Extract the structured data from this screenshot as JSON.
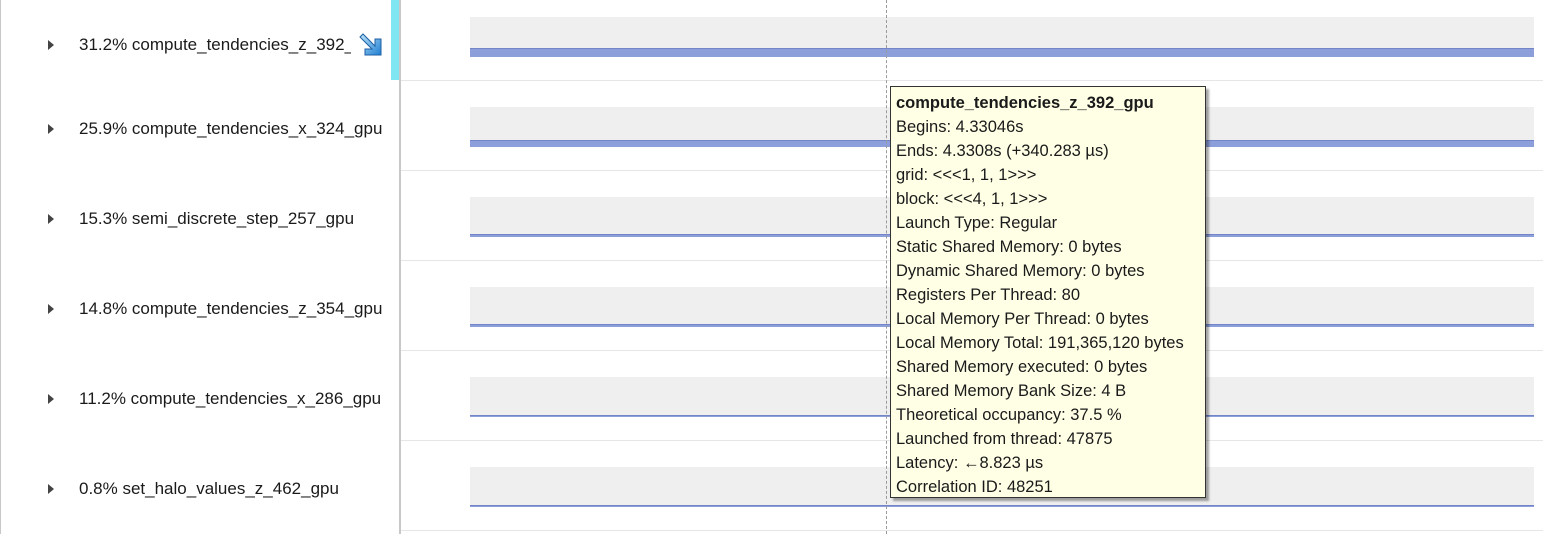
{
  "rows": [
    {
      "label": "31.2% compute_tendencies_z_392_",
      "truncated": true,
      "selected": true,
      "bar_fill": 0.22
    },
    {
      "label": "25.9% compute_tendencies_x_324_gpu",
      "truncated": false,
      "selected": false,
      "bar_fill": 0.18
    },
    {
      "label": "15.3% semi_discrete_step_257_gpu",
      "truncated": false,
      "selected": false,
      "bar_fill": 0.08
    },
    {
      "label": "14.8% compute_tendencies_z_354_gpu",
      "truncated": false,
      "selected": false,
      "bar_fill": 0.07
    },
    {
      "label": "11.2% compute_tendencies_x_286_gpu",
      "truncated": false,
      "selected": false,
      "bar_fill": 0.06
    },
    {
      "label": "0.8% set_halo_values_z_462_gpu",
      "truncated": false,
      "selected": false,
      "bar_fill": 0.03
    }
  ],
  "tooltip": {
    "title": "compute_tendencies_z_392_gpu",
    "lines": [
      "Begins: 4.33046s",
      "Ends: 4.3308s (+340.283 µs)",
      "grid:  <<<1, 1, 1>>>",
      "block: <<<4, 1, 1>>>",
      "Launch Type: Regular",
      "Static Shared Memory: 0 bytes",
      "Dynamic Shared Memory: 0 bytes",
      "Registers Per Thread: 80",
      "Local Memory Per Thread: 0 bytes",
      "Local Memory Total: 191,365,120 bytes",
      "Shared Memory executed: 0 bytes",
      "Shared Memory Bank Size: 4 B",
      "Theoretical occupancy: 37.5 %",
      "Launched from thread: 47875",
      "Latency: ←8.823 µs",
      "Correlation ID: 48251"
    ]
  },
  "icons": {
    "row_expander": "chevron-right-icon",
    "selected_row_marker": "arrow-down-right-icon"
  },
  "colors": {
    "bar": "#8d9fdb",
    "track": "#efefef",
    "selection": "#7fe6f2",
    "tooltip_bg": "#ffffe6"
  }
}
